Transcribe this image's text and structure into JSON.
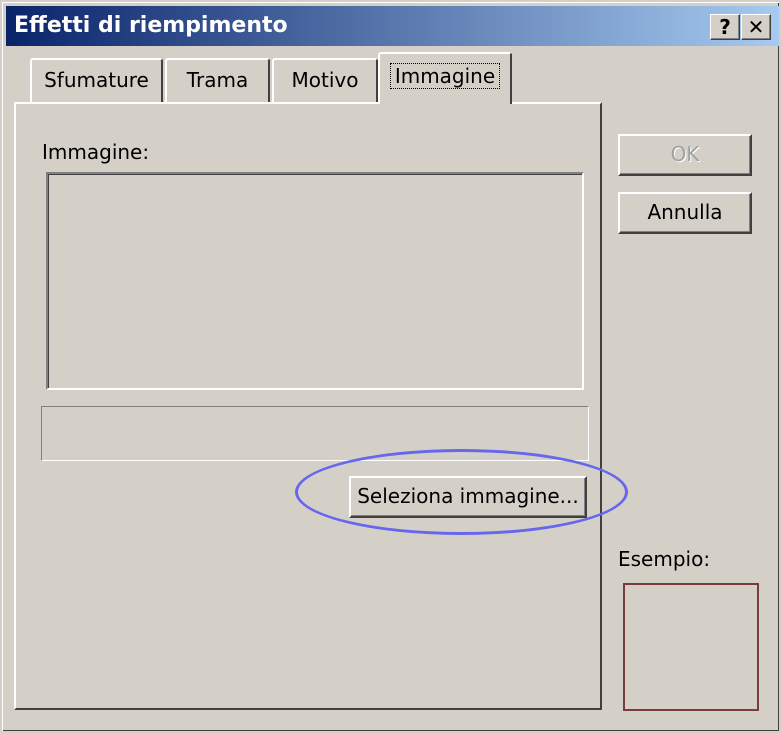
{
  "window": {
    "title": "Effetti di riempimento",
    "help_label": "?",
    "close_label": "✕"
  },
  "tabs": [
    {
      "label": "Sfumature",
      "active": false
    },
    {
      "label": "Trama",
      "active": false
    },
    {
      "label": "Motivo",
      "active": false
    },
    {
      "label": "Immagine",
      "active": true
    }
  ],
  "panel": {
    "image_label": "Immagine:",
    "select_button_label": "Seleziona immagine...",
    "filename_value": ""
  },
  "buttons": {
    "ok_label": "OK",
    "cancel_label": "Annulla"
  },
  "sample": {
    "label": "Esempio:"
  },
  "colors": {
    "titlebar_start": "#0a246a",
    "titlebar_end": "#a6caf0",
    "dialog_bg": "#d4d0c8",
    "highlight_ring": "#6666ee",
    "sample_border": "#7b3b3b"
  }
}
